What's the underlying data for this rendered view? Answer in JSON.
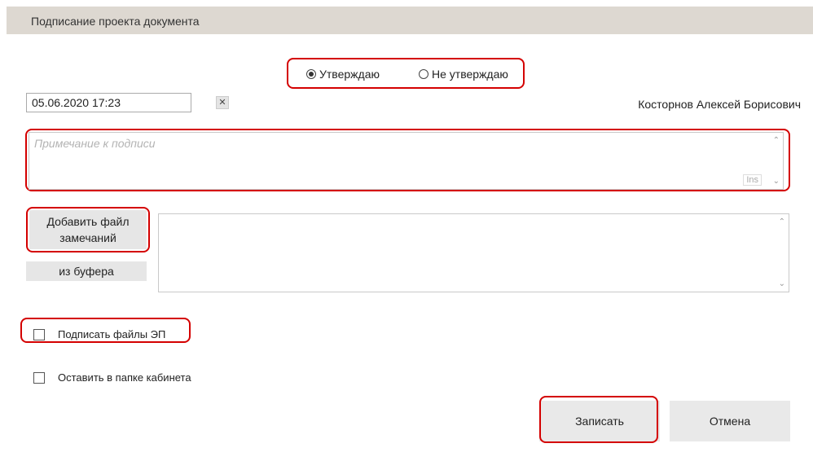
{
  "dialog": {
    "title": "Подписание проекта документа"
  },
  "decision": {
    "approve_label": "Утверждаю",
    "reject_label": "Не утверждаю",
    "selected": "approve"
  },
  "date_field": {
    "value": "05.06.2020 17:23",
    "clear_glyph": "✕"
  },
  "signer": {
    "name": "Косторнов Алексей Борисович"
  },
  "note": {
    "placeholder": "Примечание к подписи",
    "ins_badge": "Ins",
    "scroll_up": "⌃",
    "scroll_down": "⌄"
  },
  "attachments": {
    "add_file_label": "Добавить файл замечаний",
    "from_clipboard_label": "из буфера",
    "scroll_up": "⌃",
    "scroll_down": "⌄"
  },
  "options": {
    "sign_files_label": "Подписать файлы ЭП",
    "sign_files_checked": false,
    "keep_in_folder_label": "Оставить в папке кабинета",
    "keep_in_folder_checked": false
  },
  "actions": {
    "save_label": "Записать",
    "cancel_label": "Отмена"
  },
  "colors": {
    "highlight": "#d40000",
    "titlebar_bg": "#ddd8d1",
    "button_bg": "#e9e9e9"
  }
}
